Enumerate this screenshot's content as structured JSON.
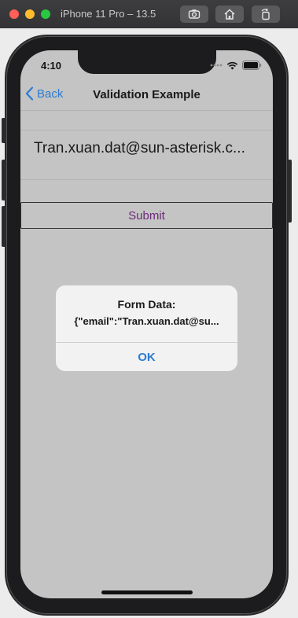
{
  "window": {
    "title": "iPhone 11 Pro – 13.5",
    "buttons": {
      "screenshot_icon": "camera-icon",
      "home_icon": "home-icon",
      "rotate_icon": "rotate-icon"
    }
  },
  "status_bar": {
    "time": "4:10",
    "icons": [
      "cellular-dots-icon",
      "wifi-icon",
      "battery-icon"
    ]
  },
  "navbar": {
    "back_label": "Back",
    "title": "Validation Example"
  },
  "form": {
    "email_value": "Tran.xuan.dat@sun-asterisk.c...",
    "submit_label": "Submit"
  },
  "alert": {
    "title": "Form Data:",
    "message": "{\"email\":\"Tran.xuan.dat@su...",
    "ok_label": "OK"
  },
  "colors": {
    "accent": "#2d7bd0",
    "submit_text": "#6b2a7a",
    "screen_bg": "#c4c4c4"
  }
}
